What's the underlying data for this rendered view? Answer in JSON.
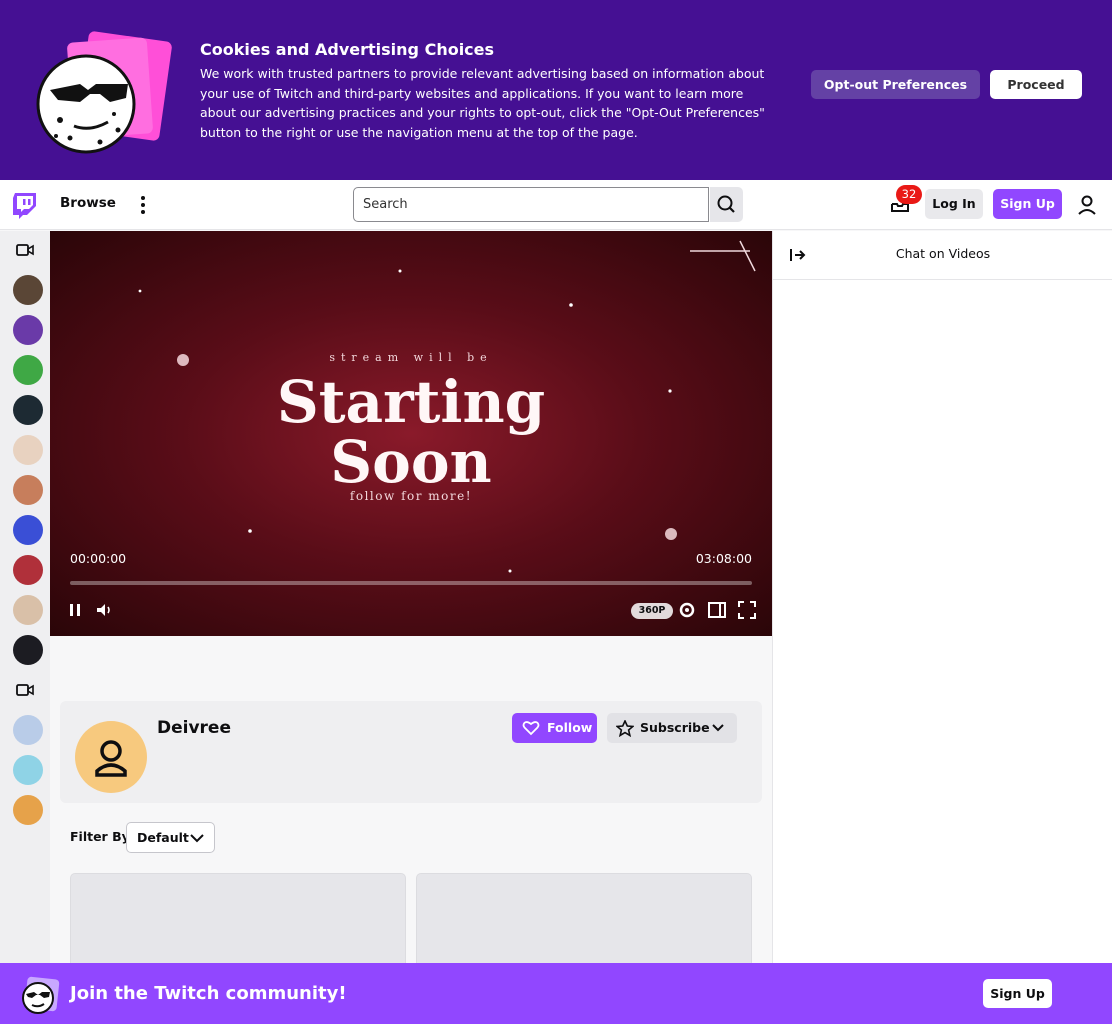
{
  "cookie_banner": {
    "title": "Cookies and Advertising Choices",
    "text": "We work with trusted partners to provide relevant advertising based on information about your use of Twitch and third-party websites and applications. If you want to learn more about our advertising practices and your rights to opt-out, click the \"Opt-Out Preferences\" button to the right or use the navigation menu at the top of the page.",
    "optout_label": "Opt-out Preferences",
    "proceed_label": "Proceed"
  },
  "nav": {
    "browse_label": "Browse",
    "search_placeholder": "Search",
    "notification_count": "32",
    "login_label": "Log In",
    "signup_label": "Sign Up"
  },
  "sidebar": {
    "avatar_colors": [
      "#5a4636",
      "#6a3aa8",
      "#3fa845",
      "#1d2a33",
      "#e8d2c0",
      "#c77e5c",
      "#3a4fd6",
      "#b0303a",
      "#d9c0a8",
      "#1c1c22",
      "#b9cce8",
      "#8fd3e6",
      "#e6a24a"
    ]
  },
  "player": {
    "overlay_small": "stream will be",
    "overlay_line1": "Starting",
    "overlay_line2": "Soon",
    "overlay_follow": "follow for more!",
    "current_time": "00:00:00",
    "duration": "03:08:00",
    "quality": "360P",
    "progress": 0.0
  },
  "chat": {
    "title": "Chat on Videos"
  },
  "channel": {
    "name": "Deivree",
    "follow_label": "Follow",
    "subscribe_label": "Subscribe"
  },
  "filter": {
    "label": "Filter By",
    "selected": "Default"
  },
  "bottom_banner": {
    "text": "Join the Twitch community!",
    "signup_label": "Sign Up"
  },
  "colors": {
    "brand_purple": "#9147ff",
    "banner_purple": "#451093",
    "badge_red": "#e91916"
  }
}
